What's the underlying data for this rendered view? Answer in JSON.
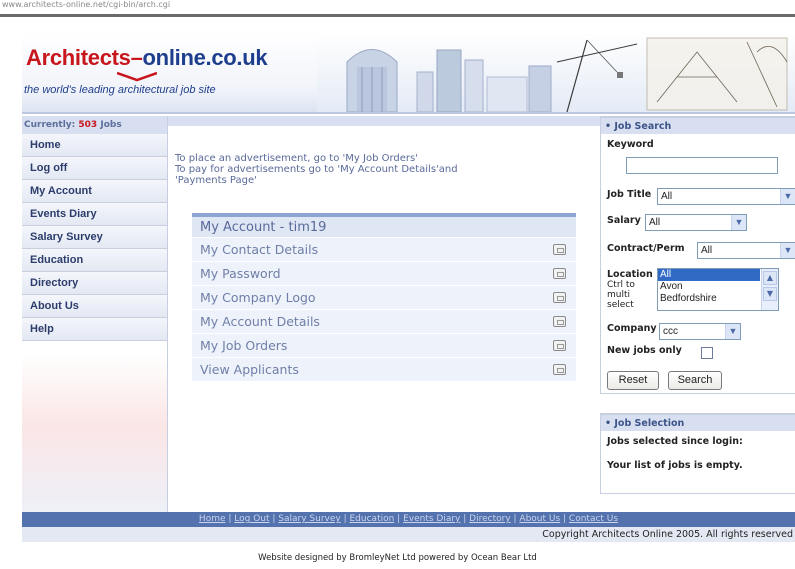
{
  "url": "www.architects-online.net/cgi-bin/arch.cgi",
  "brand": {
    "logo_part1": "Architects",
    "logo_dash": "–",
    "logo_part2": "online.co.uk",
    "tagline": "the world's leading architectural job site",
    "colors": {
      "red": "#c8161d",
      "blue": "#1d3e8c"
    }
  },
  "status": {
    "currently_label": "Currently:",
    "job_count": "503",
    "jobs_word": "Jobs"
  },
  "nav": {
    "items": [
      {
        "label": "Home"
      },
      {
        "label": "Log off"
      },
      {
        "label": "My Account"
      },
      {
        "label": "Events Diary"
      },
      {
        "label": "Salary Survey"
      },
      {
        "label": "Education"
      },
      {
        "label": "Directory"
      },
      {
        "label": "About Us"
      },
      {
        "label": "Help"
      }
    ]
  },
  "main": {
    "intro_line1": "To place an advertisement, go to 'My Job Orders'",
    "intro_line2": "To pay for advertisements go to 'My Account Details'and",
    "intro_line3": "'Payments Page'",
    "account_title": "My Account - tim19",
    "account_links": [
      {
        "label": "My Contact Details"
      },
      {
        "label": "My Password"
      },
      {
        "label": "My Company Logo"
      },
      {
        "label": "My Account Details"
      },
      {
        "label": "My Job Orders"
      },
      {
        "label": "View Applicants"
      }
    ]
  },
  "search": {
    "header": "• Job Search",
    "keyword_label": "Keyword",
    "keyword_value": "",
    "jobtitle_label": "Job Title",
    "jobtitle_value": "All",
    "salary_label": "Salary",
    "salary_value": "All",
    "contract_label": "Contract/Perm",
    "contract_value": "All",
    "location_label": "Location",
    "location_note_1": "Ctrl to",
    "location_note_2": "multi",
    "location_note_3": "select",
    "location_options": [
      "All",
      "Avon",
      "Bedfordshire"
    ],
    "location_selected": "All",
    "company_label": "Company",
    "company_value": "ccc",
    "newjobs_label": "New jobs only",
    "reset_label": "Reset",
    "search_label": "Search"
  },
  "selection": {
    "header": "• Job Selection",
    "since_login": "Jobs selected since login:",
    "empty_msg": "Your list of jobs is empty."
  },
  "footer": {
    "links": [
      "Home",
      "Log Out",
      "Salary Survey",
      "Education",
      "Events Diary",
      "Directory",
      "About Us",
      "Contact Us"
    ],
    "copyright": "Copyright Architects Online 2005. All rights reserved",
    "designed_by": "Website designed by BromleyNet Ltd    powered by Ocean Bear Ltd"
  }
}
